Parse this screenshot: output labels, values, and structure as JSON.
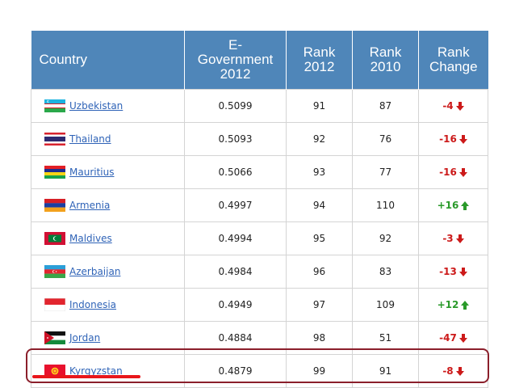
{
  "headers": {
    "country": "Country",
    "egov_lines": [
      "E-",
      "Government",
      "2012"
    ],
    "rank2012_lines": [
      "Rank",
      "2012"
    ],
    "rank2010_lines": [
      "Rank",
      "2010"
    ],
    "change_lines": [
      "Rank",
      "Change"
    ]
  },
  "rows": [
    {
      "country": "Uzbekistan",
      "egov": "0.5099",
      "rank2012": "91",
      "rank2010": "87",
      "change": "-4",
      "direction": "down",
      "flag_icon": "uzbekistan-flag-icon"
    },
    {
      "country": "Thailand",
      "egov": "0.5093",
      "rank2012": "92",
      "rank2010": "76",
      "change": "-16",
      "direction": "down",
      "flag_icon": "thailand-flag-icon"
    },
    {
      "country": "Mauritius",
      "egov": "0.5066",
      "rank2012": "93",
      "rank2010": "77",
      "change": "-16",
      "direction": "down",
      "flag_icon": "mauritius-flag-icon"
    },
    {
      "country": "Armenia",
      "egov": "0.4997",
      "rank2012": "94",
      "rank2010": "110",
      "change": "+16",
      "direction": "up",
      "flag_icon": "armenia-flag-icon"
    },
    {
      "country": "Maldives",
      "egov": "0.4994",
      "rank2012": "95",
      "rank2010": "92",
      "change": "-3",
      "direction": "down",
      "flag_icon": "maldives-flag-icon"
    },
    {
      "country": "Azerbaijan",
      "egov": "0.4984",
      "rank2012": "96",
      "rank2010": "83",
      "change": "-13",
      "direction": "down",
      "flag_icon": "azerbaijan-flag-icon"
    },
    {
      "country": "Indonesia",
      "egov": "0.4949",
      "rank2012": "97",
      "rank2010": "109",
      "change": "+12",
      "direction": "up",
      "flag_icon": "indonesia-flag-icon"
    },
    {
      "country": "Jordan",
      "egov": "0.4884",
      "rank2012": "98",
      "rank2010": "51",
      "change": "-47",
      "direction": "down",
      "flag_icon": "jordan-flag-icon"
    },
    {
      "country": "Kyrgyzstan",
      "egov": "0.4879",
      "rank2012": "99",
      "rank2010": "91",
      "change": "-8",
      "direction": "down",
      "flag_icon": "kyrgyzstan-flag-icon"
    }
  ],
  "colors": {
    "header_bg": "#4f86b9",
    "negative": "#cc1a1a",
    "positive": "#2a9a2a",
    "highlight_box": "#8b1f2b",
    "underline": "#e8161b",
    "link": "#2f63b7"
  }
}
